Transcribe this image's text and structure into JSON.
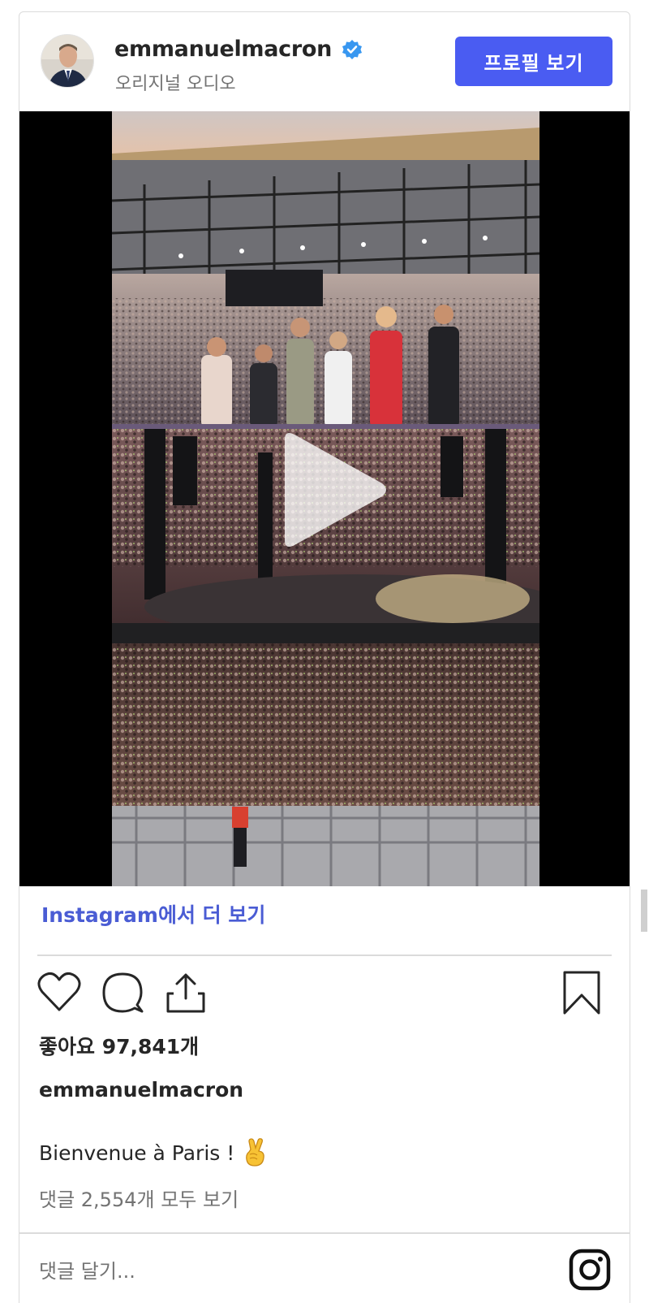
{
  "header": {
    "username": "emmanuelmacron",
    "audio_label": "오리지널 오디오",
    "profile_button": "프로필 보기",
    "verified_icon": "verified-badge-icon",
    "accent_color": "#4a5cf2"
  },
  "media": {
    "type": "video",
    "play_icon": "play-icon"
  },
  "footer": {
    "more_link": "Instagram에서 더 보기",
    "likes": "좋아요 97,841개",
    "author": "emmanuelmacron",
    "caption": "Bienvenue à Paris !",
    "caption_emoji": "crossed-fingers-icon",
    "comments_link": "댓글 2,554개 모두 보기",
    "comment_placeholder": "댓글 달기...",
    "icons": [
      "heart-icon",
      "comment-icon",
      "share-icon",
      "bookmark-icon",
      "instagram-icon"
    ]
  }
}
